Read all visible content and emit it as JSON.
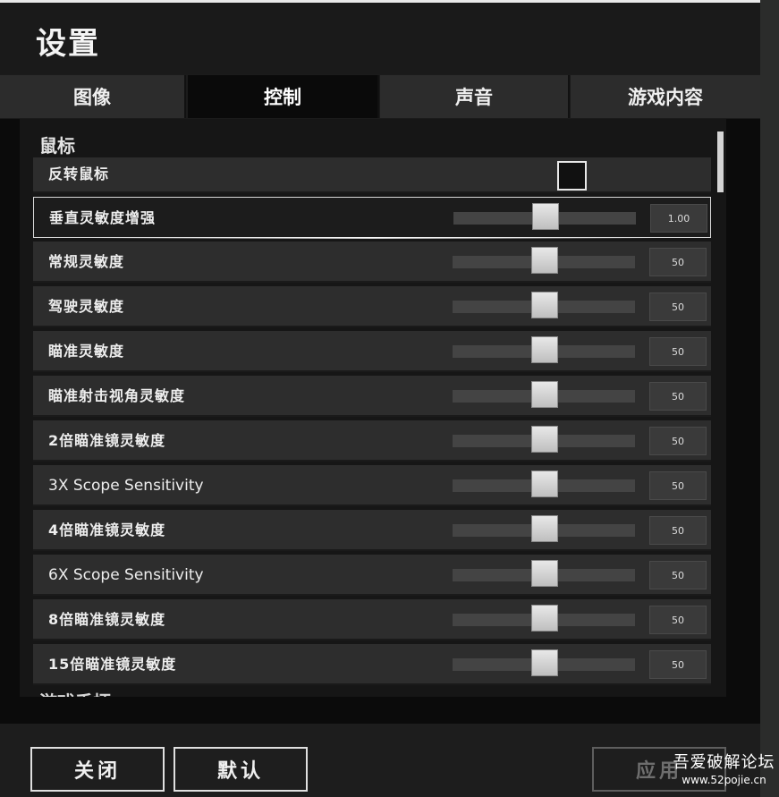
{
  "title": "设置",
  "tabs": [
    {
      "label": "图像",
      "active": false
    },
    {
      "label": "控制",
      "active": true
    },
    {
      "label": "声音",
      "active": false
    },
    {
      "label": "游戏内容",
      "active": false
    }
  ],
  "sections": {
    "mouse_title": "鼠标",
    "next_title": "游戏手柄"
  },
  "invert_mouse": {
    "label": "反转鼠标",
    "checked": false
  },
  "sliders": [
    {
      "label": "垂直灵敏度增强",
      "value": "1.00",
      "fraction": 0.5,
      "highlight": true
    },
    {
      "label": "常规灵敏度",
      "value": "50",
      "fraction": 0.5
    },
    {
      "label": "驾驶灵敏度",
      "value": "50",
      "fraction": 0.5
    },
    {
      "label": "瞄准灵敏度",
      "value": "50",
      "fraction": 0.5
    },
    {
      "label": "瞄准射击视角灵敏度",
      "value": "50",
      "fraction": 0.5
    },
    {
      "label": "2倍瞄准镜灵敏度",
      "value": "50",
      "fraction": 0.5
    },
    {
      "label": "3X Scope Sensitivity",
      "value": "50",
      "fraction": 0.5
    },
    {
      "label": "4倍瞄准镜灵敏度",
      "value": "50",
      "fraction": 0.5
    },
    {
      "label": "6X Scope Sensitivity",
      "value": "50",
      "fraction": 0.5
    },
    {
      "label": "8倍瞄准镜灵敏度",
      "value": "50",
      "fraction": 0.5
    },
    {
      "label": "15倍瞄准镜灵敏度",
      "value": "50",
      "fraction": 0.5
    }
  ],
  "buttons": {
    "close": "关闭",
    "default": "默认",
    "apply": "应用"
  },
  "watermark": {
    "line1": "吾爱破解论坛",
    "line2": "www.52pojie.cn"
  }
}
